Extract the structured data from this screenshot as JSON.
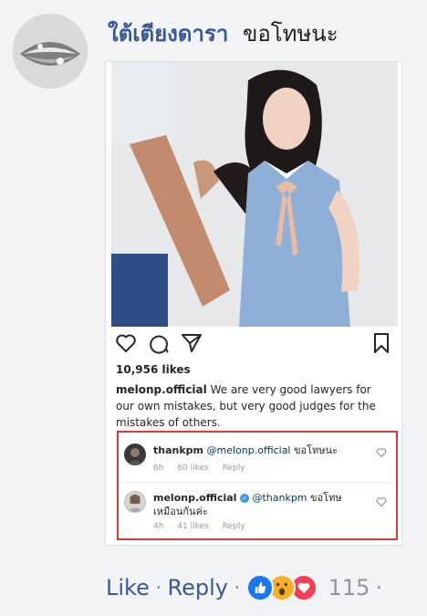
{
  "comment": {
    "author": "ใต้เตียงดารา",
    "text": "ขอโทษนะ"
  },
  "post": {
    "likes": "10,956 likes",
    "username": "melonp.official",
    "caption": "We are very good lawyers for our own mistakes, but very good judges for the mistakes of others.",
    "icons": [
      "heart-icon",
      "comment-icon",
      "share-icon",
      "bookmark-icon"
    ]
  },
  "comments": [
    {
      "username": "thankpm",
      "mention": "@melonp.official",
      "text": "ขอโทษนะ",
      "time": "6h",
      "likes": "60 likes",
      "reply": "Reply"
    },
    {
      "username": "melonp.official",
      "verified": true,
      "mention": "@thankpm",
      "text": "ขอโทษ เหมือนกันค่ะ",
      "time": "4h",
      "likes": "41 likes",
      "reply": "Reply"
    }
  ],
  "footer": {
    "like": "Like",
    "reply": "Reply",
    "separator": "·",
    "reaction_count": "115",
    "reactions": [
      "like-reaction",
      "wow-reaction",
      "love-reaction"
    ]
  },
  "colors": {
    "link": "#385898",
    "highlight_border": "#d93a3a",
    "like_blue": "#1877f2",
    "love_red": "#f33e58",
    "wow_yellow": "#f7b125"
  }
}
